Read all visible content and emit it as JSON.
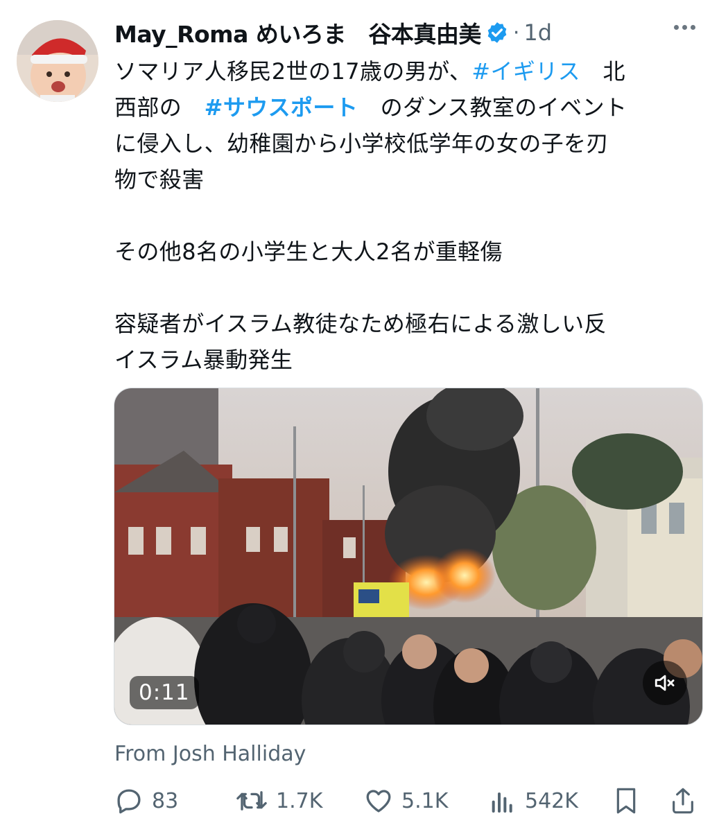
{
  "author": {
    "display_name": "May_Roma めいろま　谷本真由美",
    "verified": true,
    "avatar_icon": "baby-avatar"
  },
  "time_separator": "·",
  "timestamp": "1d",
  "tweet": {
    "line1_a": "ソマリア人移民2世の17歳の男が、",
    "hashtag1": "#イギリス",
    "line1_b": "　北",
    "line2_a": "西部の　",
    "hashtag2": "#サウスポート",
    "line2_b": "　のダンス教室のイベント",
    "line3": "に侵入し、幼稚園から小学校低学年の女の子を刃",
    "line4": "物で殺害",
    "paragraph2": "その他8名の小学生と大人2名が重軽傷",
    "paragraph3_line1": "容疑者がイスラム教徒なため極右による激しい反",
    "paragraph3_line2": "イスラム暴動発生"
  },
  "media": {
    "duration": "0:11",
    "mute_icon": "speaker-muted-icon"
  },
  "source_text": "From Josh Halliday",
  "actions": {
    "reply_count": "83",
    "retweet_count": "1.7K",
    "like_count": "5.1K",
    "view_count": "542K"
  },
  "colors": {
    "hashtag": "#1d9bf0",
    "secondary_text": "#536471",
    "verified": "#1d9bf0"
  }
}
